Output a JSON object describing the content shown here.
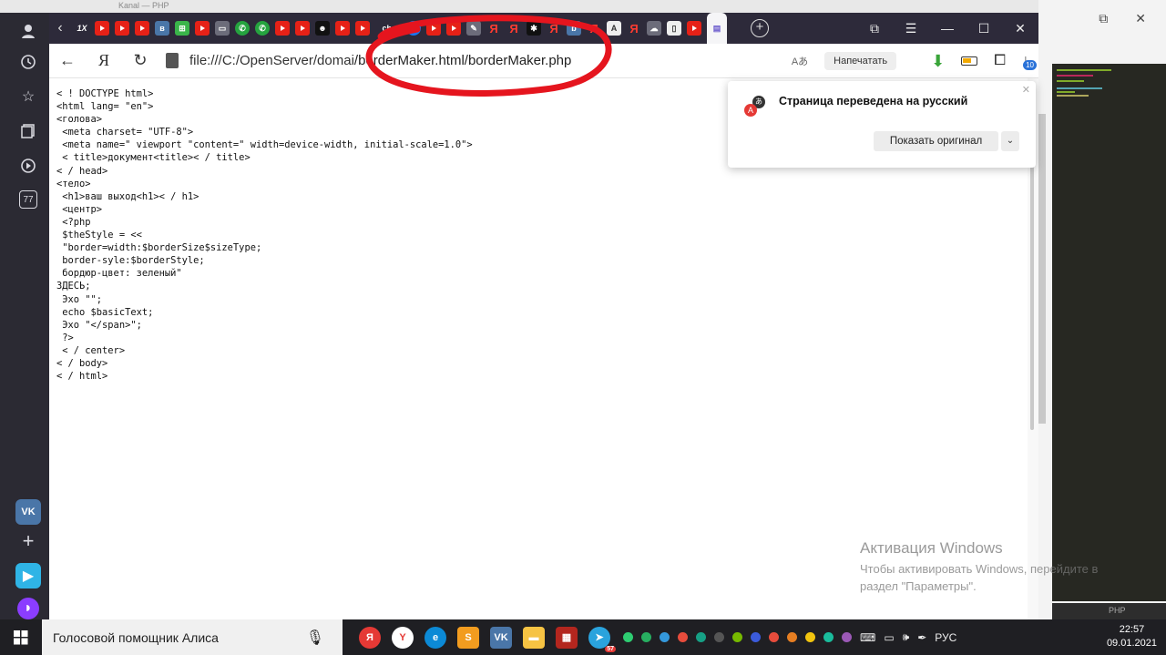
{
  "background_window": {
    "status_label": "PHP"
  },
  "topstrip": {
    "title": "Kanal — PHP"
  },
  "sidebar": {
    "counter": "77"
  },
  "tabbar": {
    "tab_labels": [
      "1X",
      "ch.",
      "b",
      "Я"
    ],
    "window_controls": {
      "collections": "⧉",
      "menu": "☰",
      "minimize": "—",
      "maximize": "☐",
      "close": "✕"
    }
  },
  "address_bar": {
    "url_prefix": "file:///C:/OpenServer/domai",
    "url_highlight": "/borderMaker.html/borderMaker.php",
    "print_label": "Напечатать",
    "downloads_badge": "10"
  },
  "page": {
    "lines": [
      "< ! DOCTYPE html>",
      "<html lang= \"en\">",
      "<голова>",
      " <meta charset= \"UTF-8\">",
      " <meta name=\" viewport \"content=\" width=device-width, initial-scale=1.0\">",
      " < title>документ<title>< / title>",
      "< / head>",
      "<тело>",
      " <h1>ваш выход<h1>< / h1>",
      " <центр>",
      " <?php",
      " $theStyle = <<",
      " \"border=width:$borderSize$sizeType;",
      " border-syle:$borderStyle;",
      " бордюр-цвет: зеленый\"",
      "ЗДЕСЬ;",
      " Эхо \"\";",
      " echo $basicText;",
      " Эхо \"</span>\";",
      " ?>",
      " < / center>",
      "< / body>",
      "< / html>"
    ]
  },
  "translate_popup": {
    "title": "Страница переведена на русский",
    "show_original_label": "Показать оригинал"
  },
  "activation": {
    "title": "Активация Windows",
    "line1": "Чтобы активировать Windows, перейдите в",
    "line2": "раздел \"Параметры\"."
  },
  "taskbar": {
    "search_text": "Голосовой помощник Алиса",
    "language": "РУС",
    "time": "22:57",
    "date": "09.01.2021",
    "telegram_badge": "57"
  },
  "colors": {
    "marker_red": "#e5151e",
    "tab_bar": "#2d2a3a",
    "sidebar": "#2b2a33",
    "taskbar": "#1f1f23",
    "link_blue": "#2a72d8"
  }
}
